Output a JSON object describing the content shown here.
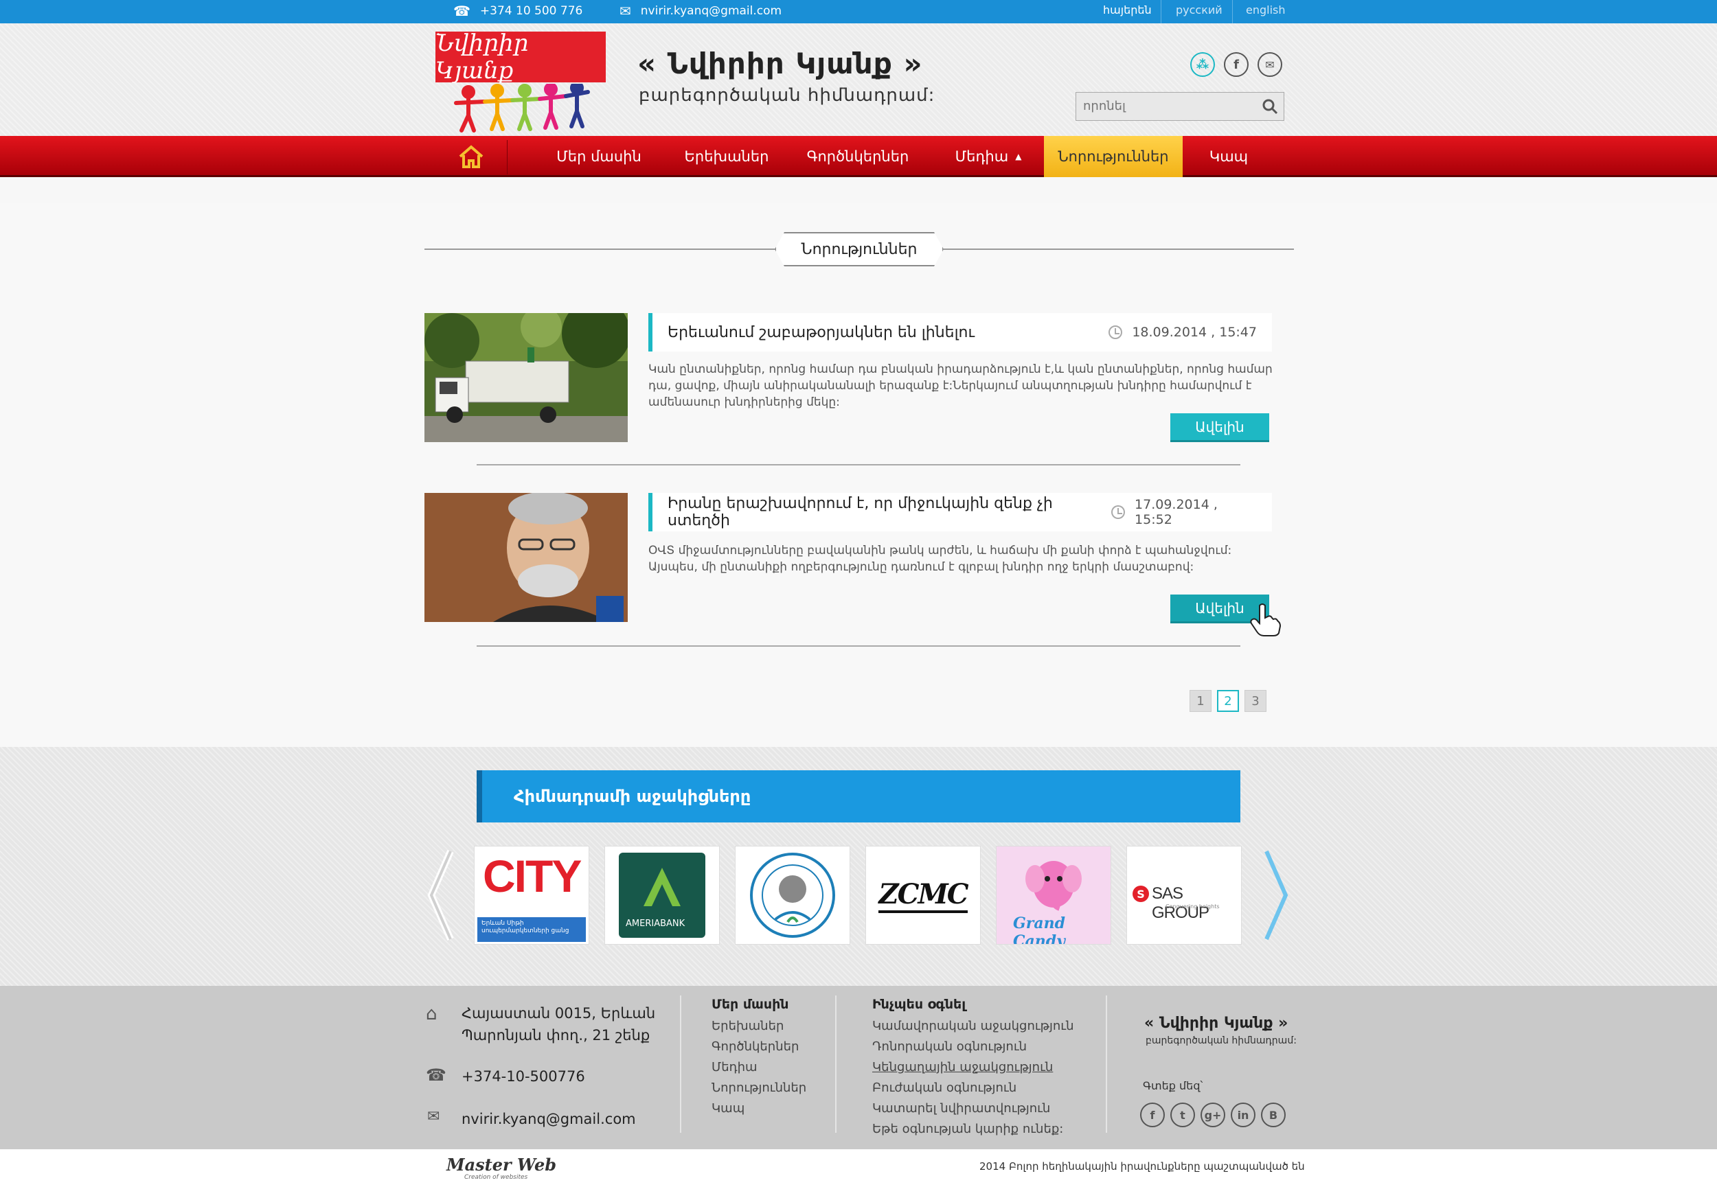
{
  "topbar": {
    "phone": "+374 10 500 776",
    "email": "nvirir.kyanq@gmail.com",
    "languages": [
      "հայերեն",
      "русский",
      "english"
    ]
  },
  "header": {
    "logo_text": "Նվիրիր Կյանք",
    "title": "« Նվիրիր Կյանք »",
    "subtitle": "բարեգործական հիմնադրամ:",
    "search_placeholder": "որոնել"
  },
  "nav": {
    "items": [
      "Մեր մասին",
      "Երեխաներ",
      "Գործնկերներ",
      "Մեդիա",
      "Նորություններ",
      "Կապ"
    ],
    "active": "Նորություններ"
  },
  "section_title": "Նորություններ",
  "news": [
    {
      "title": "Երեւանում շաբաթօրյակներ են լինելու",
      "date": "18.09.2014 , 15:47",
      "text": "Կան ընտանիքներ, որոնց համար դա բնական իրադարձություն է,և կան ընտանիքներ, որոնց համար դա, ցավոք, միայն անիրականանալի երազանք է:Ներկայում անպտղության խնդիրը համարվում է ամենասուր խնդիրներից մեկը:",
      "more": "Ավելին"
    },
    {
      "title": "Իրանը երաշխավորում է, որ միջուկային զենք չի ստեղծի",
      "date": "17.09.2014 , 15:52",
      "text": "ՕՎՏ միջամտությունները բավականին թանկ արժեն, և հաճախ մի քանի փորձ է պահանջվում: Այսպես, մի ընտանիքի ողբերգությունը դառնում է գլոբալ խնդիր ողջ երկրի մասշտաբով:",
      "more": "Ավելին"
    }
  ],
  "pagination": [
    "1",
    "2",
    "3"
  ],
  "pagination_active": "2",
  "sponsors": {
    "title": "Հիմնադրամի աջակիցները",
    "logos": [
      {
        "name": "city",
        "text": "CITY",
        "caption": "Երևան Սիթի սուպերմարկետների ցանց"
      },
      {
        "name": "ameriabank",
        "text": "AMERIABANK"
      },
      {
        "name": "university",
        "text": ""
      },
      {
        "name": "zcmc",
        "text": "ZCMC"
      },
      {
        "name": "grand-candy",
        "text": "Grand Candy"
      },
      {
        "name": "sas-group",
        "text": "SAS GROUP",
        "caption": "Conquering heights"
      }
    ]
  },
  "footer": {
    "address_line1": "Հայաստան 0015, Երևան",
    "address_line2": "Պարոնյան փող., 21 շենք",
    "phone": "+374-10-500776",
    "email": "nvirir.kyanq@gmail.com",
    "col1_title": "Մեր մասին",
    "col1_links": [
      "Երեխաներ",
      "Գործնկերներ",
      "Մեդիա",
      "Նորություններ",
      "Կապ"
    ],
    "col2_title": "Ինչպես օգնել",
    "col2_links": [
      "Կամավորական աջակցություն",
      "Դոնորական օգնություն",
      "Կենցաղային աջակցություն",
      "Բուժական օգնություն",
      "Կատարել նվիրատվություն",
      "Եթե օգնության կարիք ունեք:"
    ],
    "brand_title": "« Նվիրիր Կյանք »",
    "brand_sub": "բարեգործական հիմնադրամ:",
    "find_us": "Գտեք մեզ՝",
    "social": [
      "f",
      "t",
      "g+",
      "in",
      "B"
    ]
  },
  "bottom": {
    "developer": "Master Web",
    "developer_sub": "Creation of websites",
    "copyright": "2014 Բոլոր հեղինակային իրավունքները պաշտպանված են"
  },
  "colors": {
    "topbar": "#1a8fd6",
    "nav_red": "#d0101a",
    "nav_active": "#f5c030",
    "accent": "#1eb8c4",
    "sponsor_blue": "#1a99e0"
  }
}
